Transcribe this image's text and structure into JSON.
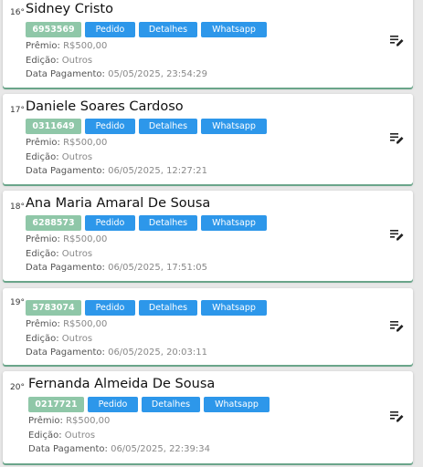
{
  "labels": {
    "premio": "Prêmio:",
    "edicao": "Edição:",
    "data_pagamento": "Data Pagamento:"
  },
  "buttons": {
    "pedido": "Pedido",
    "detalhes": "Detalhes",
    "whatsapp": "Whatsapp"
  },
  "icons": {
    "edit": "edit-note-icon"
  },
  "colors": {
    "code_chip": "#8fc7a8",
    "button": "#2d97ea",
    "card_underline": "#6aa58a"
  },
  "cards": [
    {
      "rank": "16°",
      "name": "Sidney Cristo",
      "code": "6953569",
      "premio": "R$500,00",
      "edicao": "Outros",
      "data_pagamento": "05/05/2025, 23:54:29"
    },
    {
      "rank": "17°",
      "name": "Daniele Soares Cardoso",
      "code": "0311649",
      "premio": "R$500,00",
      "edicao": "Outros",
      "data_pagamento": "06/05/2025, 12:27:21"
    },
    {
      "rank": "18°",
      "name": "Ana Maria Amaral De Sousa",
      "code": "6288573",
      "premio": "R$500,00",
      "edicao": "Outros",
      "data_pagamento": "06/05/2025, 17:51:05"
    },
    {
      "rank": "19°",
      "name": "",
      "code": "5783074",
      "premio": "R$500,00",
      "edicao": "Outros",
      "data_pagamento": "06/05/2025, 20:03:11"
    },
    {
      "rank": "20°",
      "name": "Fernanda Almeida De Sousa",
      "code": "0217721",
      "premio": "R$500,00",
      "edicao": "Outros",
      "data_pagamento": "06/05/2025, 22:39:34"
    }
  ]
}
